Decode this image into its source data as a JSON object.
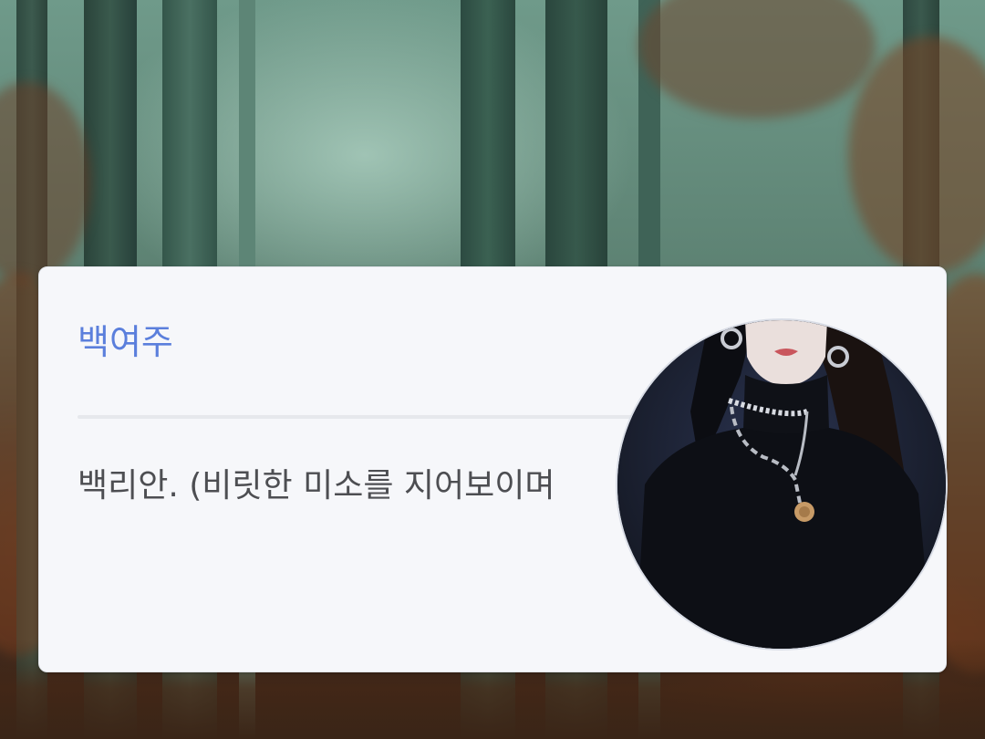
{
  "dialog": {
    "speaker_name": "백여주",
    "message": "백리안. (비릿한 미소를 지어보이며"
  },
  "colors": {
    "name_accent": "#5b7fdc",
    "message_text": "#4d4e52",
    "card_background": "#f6f7fa"
  },
  "background": {
    "scene": "misty autumn forest"
  },
  "avatar": {
    "icon": "character-portrait"
  }
}
